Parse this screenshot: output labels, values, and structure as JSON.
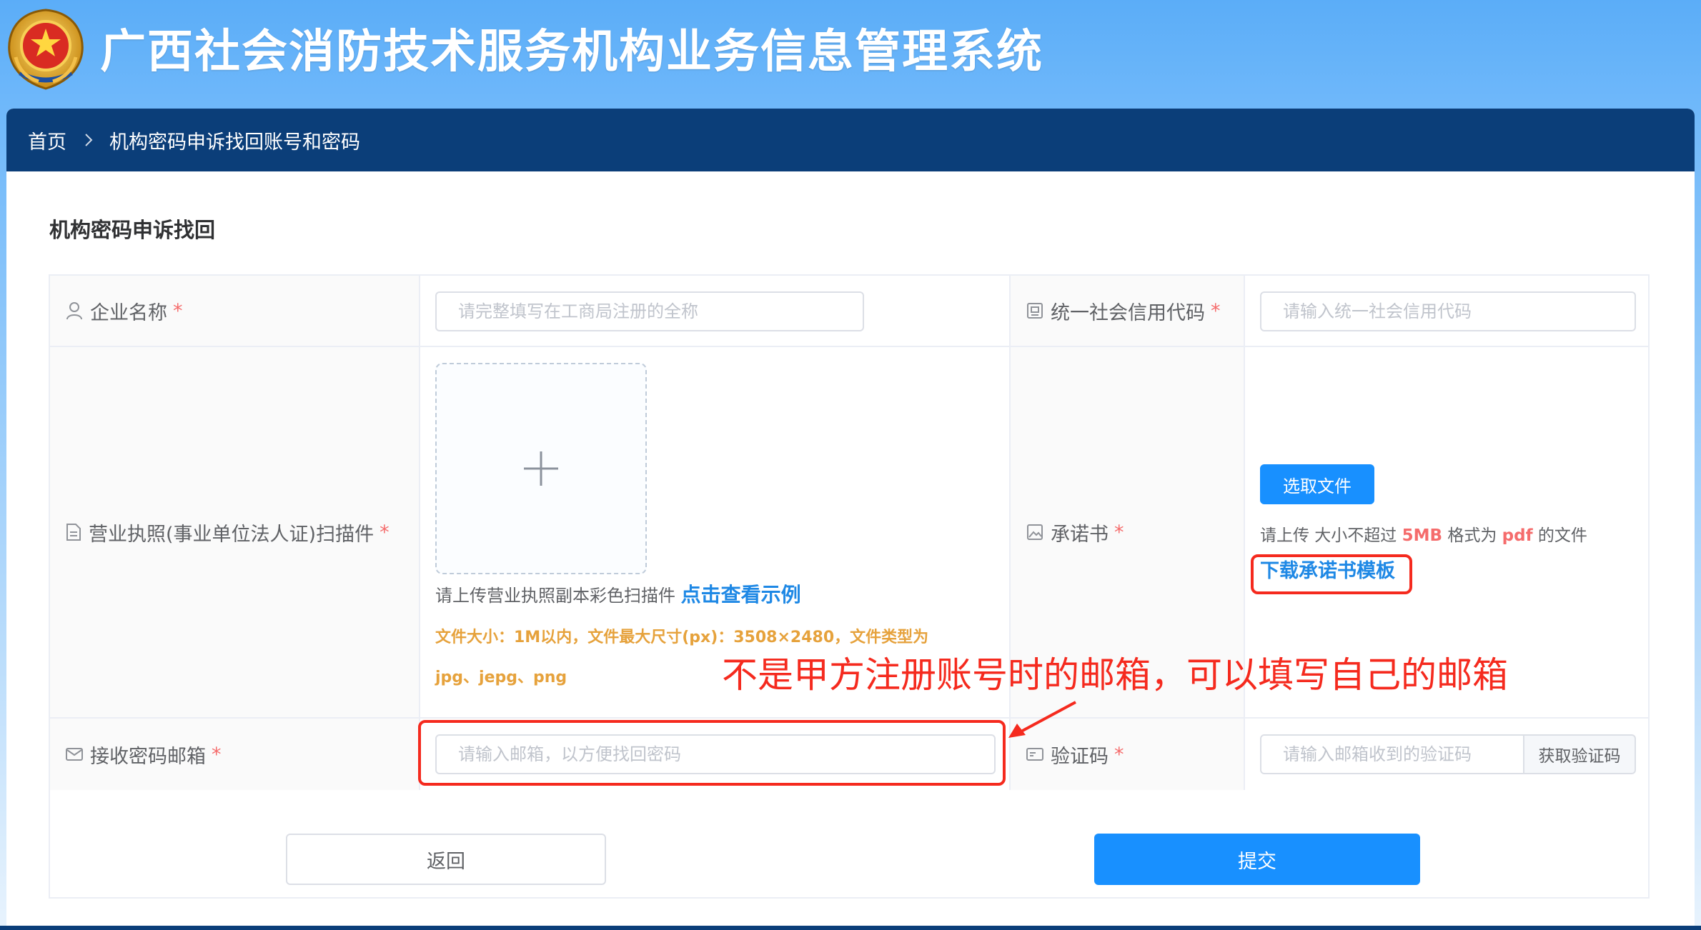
{
  "header": {
    "title": "广西社会消防技术服务机构业务信息管理系统",
    "emblem_icon": "fire-rescue-emblem-icon"
  },
  "breadcrumb": {
    "home": "首页",
    "current": "机构密码申诉找回账号和密码"
  },
  "section_title": "机构密码申诉找回",
  "form": {
    "company_name": {
      "label": "企业名称",
      "required_mark": "*",
      "placeholder": "请完整填写在工商局注册的全称",
      "icon": "user-icon"
    },
    "credit_code": {
      "label": "统一社会信用代码",
      "required_mark": "*",
      "placeholder": "请输入统一社会信用代码",
      "icon": "id-card-icon"
    },
    "license": {
      "label": "营业执照(事业单位法人证)扫描件",
      "required_mark": "*",
      "icon": "document-icon",
      "upload_icon": "plus-icon",
      "hint_prefix": "请上传营业执照副本彩色扫描件",
      "hint_link": "点击查看示例",
      "size_hint": "文件大小：1M以内，文件最大尺寸(px)：3508×2480，文件类型为",
      "type_hint": "jpg、jepg、png"
    },
    "commitment": {
      "label": "承诺书",
      "required_mark": "*",
      "icon": "picture-icon",
      "select_button": "选取文件",
      "hint_part1": "请上传 大小不超过 ",
      "hint_size": "5MB",
      "hint_part2": " 格式为 ",
      "hint_format": "pdf",
      "hint_part3": " 的文件",
      "download_link": "下载承诺书模板"
    },
    "email": {
      "label": "接收密码邮箱",
      "required_mark": "*",
      "placeholder": "请输入邮箱，以方便找回密码",
      "icon": "mail-icon"
    },
    "captcha": {
      "label": "验证码",
      "required_mark": "*",
      "placeholder": "请输入邮箱收到的验证码",
      "get_code_button": "获取验证码",
      "icon": "message-icon"
    }
  },
  "actions": {
    "back": "返回",
    "submit": "提交"
  },
  "annotation": {
    "text": "不是甲方注册账号时的邮箱，可以填写自己的邮箱",
    "color": "#f52a1e"
  },
  "colors": {
    "header_bg": "#5badf8",
    "breadcrumb_bg": "#0b3e79",
    "primary": "#1890ff",
    "required": "#f56c6c",
    "warning": "#e6a23c"
  }
}
